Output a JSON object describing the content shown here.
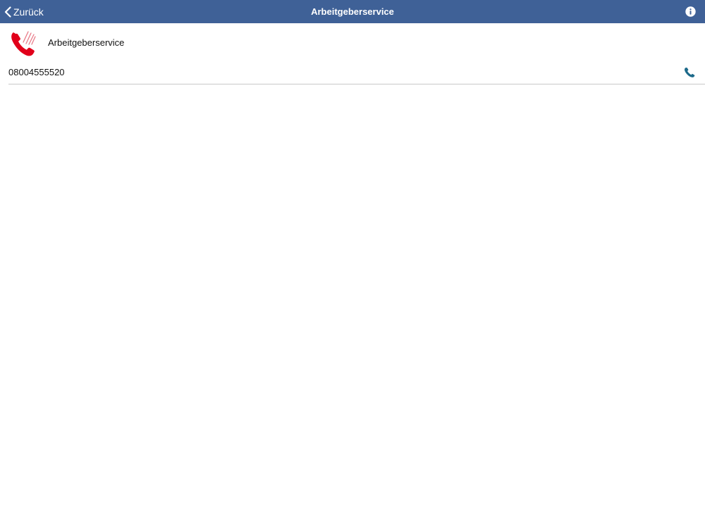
{
  "navbar": {
    "back_label": "Zurück",
    "title": "Arbeitgeberservice",
    "background_color": "#3f6197",
    "info_icon": "info-icon"
  },
  "service": {
    "name": "Arbeitgeberservice",
    "icon": "ringing-phone-icon",
    "icon_color": "#e1001a"
  },
  "contact": {
    "phone_number": "08004555520",
    "call_icon": "phone-icon",
    "call_icon_color": "#1d6a8a"
  }
}
